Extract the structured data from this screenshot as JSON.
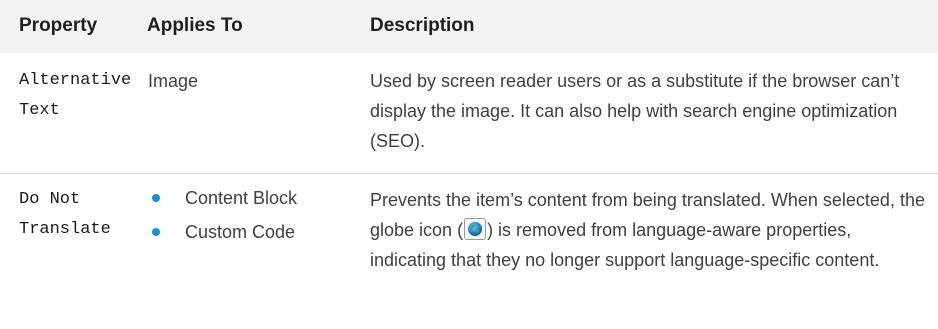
{
  "table": {
    "headers": {
      "property": "Property",
      "applies_to": "Applies To",
      "description": "Description"
    },
    "rows": [
      {
        "property": "Alternative Text",
        "applies_to": "Image",
        "description": "Used by screen reader users or as a substitute if the browser can’t display the image. It can also help with search engine optimization (SEO)."
      },
      {
        "property": "Do Not Translate",
        "applies_to": [
          "Content Block",
          "Custom Code"
        ],
        "description_before_icon": "Prevents the item’s content from being translated. When selected, the globe icon (",
        "icon": "globe-icon",
        "description_after_icon": ") is removed from language-aware properties, indicating that they no longer support language-specific content."
      }
    ]
  },
  "colors": {
    "header_background": "#f3f3f3",
    "bullet": "#1a8fd1",
    "divider": "#d9d9d9"
  }
}
